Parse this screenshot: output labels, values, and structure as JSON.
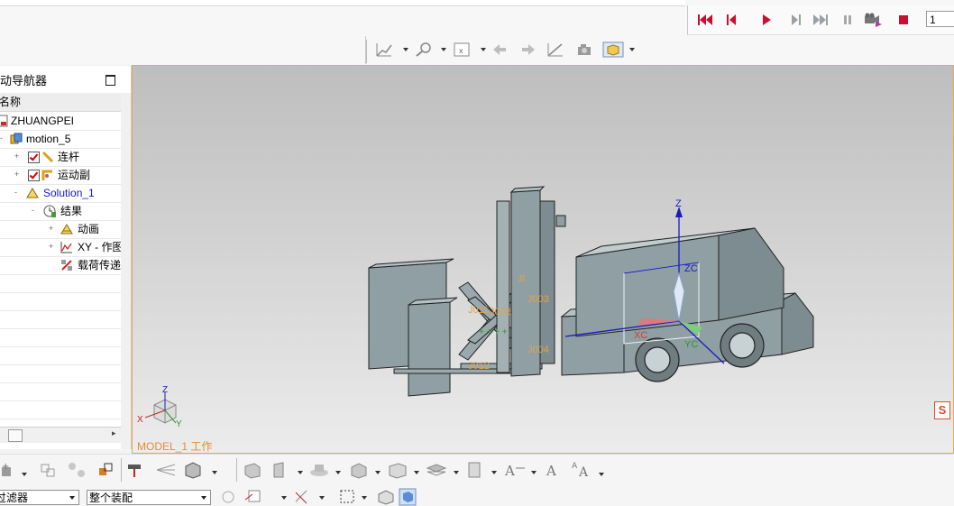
{
  "navigator": {
    "title": "运动导航器",
    "column_header": "名称",
    "items": [
      {
        "label": "ZHUANGPEI"
      },
      {
        "label": "motion_5"
      },
      {
        "label": "连杆"
      },
      {
        "label": "运动副"
      },
      {
        "label": "Solution_1"
      },
      {
        "label": "结果"
      },
      {
        "label": "动画"
      },
      {
        "label": "XY - 作图"
      },
      {
        "label": "载荷传递"
      }
    ]
  },
  "playback": {
    "frame_value": "1"
  },
  "viewport": {
    "model_label": "MODEL_1 工作",
    "axis": {
      "z": "Z",
      "zc": "ZC",
      "xc": "XC",
      "yc": "YC"
    },
    "triad": {
      "x": "X",
      "y": "Y",
      "z": "Z"
    },
    "annotations": [
      "J011",
      "J008",
      "J003",
      "J004",
      "J012"
    ]
  },
  "selection_bar": {
    "filter_value": "过滤器",
    "scope_value": "整个装配"
  },
  "colors": {
    "accent_orange": "#f0a64a",
    "playback_red": "#c8102e",
    "solution_blue": "#1515c8",
    "model_gray": "#8f9fa3"
  }
}
